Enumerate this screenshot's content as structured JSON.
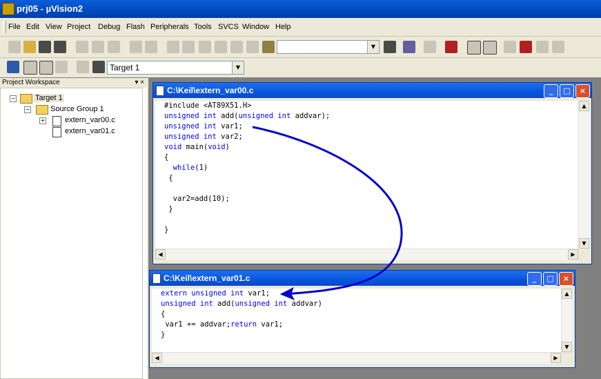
{
  "app": {
    "title": "prj05 - µVision2"
  },
  "menu": [
    "File",
    "Edit",
    "View",
    "Project",
    "Debug",
    "Flash",
    "Peripherals",
    "Tools",
    "SVCS",
    "Window",
    "Help"
  ],
  "toolbar": {
    "target_value": "Target 1",
    "find_value": ""
  },
  "workspace": {
    "title": "Project Workspace",
    "close_glyph": "▾ ×",
    "tree": {
      "target": "Target 1",
      "group": "Source Group 1",
      "files": [
        "extern_var00.c",
        "extern_var01.c"
      ]
    }
  },
  "editor1": {
    "title": "C:\\Keil\\extern_var00.c",
    "lines": [
      [
        {
          "t": "#include <AT89X51.H>",
          "k": false
        }
      ],
      [
        {
          "t": "unsigned int",
          "k": true
        },
        {
          "t": " add(",
          "k": false
        },
        {
          "t": "unsigned int",
          "k": true
        },
        {
          "t": " addvar);",
          "k": false
        }
      ],
      [
        {
          "t": "unsigned int",
          "k": true
        },
        {
          "t": " var1;",
          "k": false
        }
      ],
      [
        {
          "t": "unsigned int",
          "k": true
        },
        {
          "t": " var2;",
          "k": false
        }
      ],
      [
        {
          "t": "void",
          "k": true
        },
        {
          "t": " main(",
          "k": false
        },
        {
          "t": "void",
          "k": true
        },
        {
          "t": ")",
          "k": false
        }
      ],
      [
        {
          "t": "{",
          "k": false
        }
      ],
      [
        {
          "t": "  ",
          "k": false
        },
        {
          "t": "while",
          "k": true
        },
        {
          "t": "(1)",
          "k": false
        }
      ],
      [
        {
          "t": " {",
          "k": false
        }
      ],
      [
        {
          "t": "",
          "k": false
        }
      ],
      [
        {
          "t": "  var2=add(10);",
          "k": false
        }
      ],
      [
        {
          "t": " }",
          "k": false
        }
      ],
      [
        {
          "t": "",
          "k": false
        }
      ],
      [
        {
          "t": "}",
          "k": false
        }
      ]
    ]
  },
  "editor2": {
    "title": "C:\\Keil\\extern_var01.c",
    "lines": [
      [
        {
          "t": "extern unsigned int",
          "k": true
        },
        {
          "t": " var1;",
          "k": false
        }
      ],
      [
        {
          "t": "unsigned int",
          "k": true
        },
        {
          "t": " add(",
          "k": false
        },
        {
          "t": "unsigned int",
          "k": true
        },
        {
          "t": " addvar)",
          "k": false
        }
      ],
      [
        {
          "t": "{",
          "k": false
        }
      ],
      [
        {
          "t": " var1 += addvar;",
          "k": false
        },
        {
          "t": "return",
          "k": true
        },
        {
          "t": " var1;",
          "k": false
        }
      ],
      [
        {
          "t": "}",
          "k": false
        }
      ]
    ]
  },
  "window_buttons": {
    "minimize": "_",
    "maximize": "□",
    "close": "×"
  },
  "colors": {
    "keyword": "#0000ff",
    "annotation_arrow": "#0000cc"
  }
}
